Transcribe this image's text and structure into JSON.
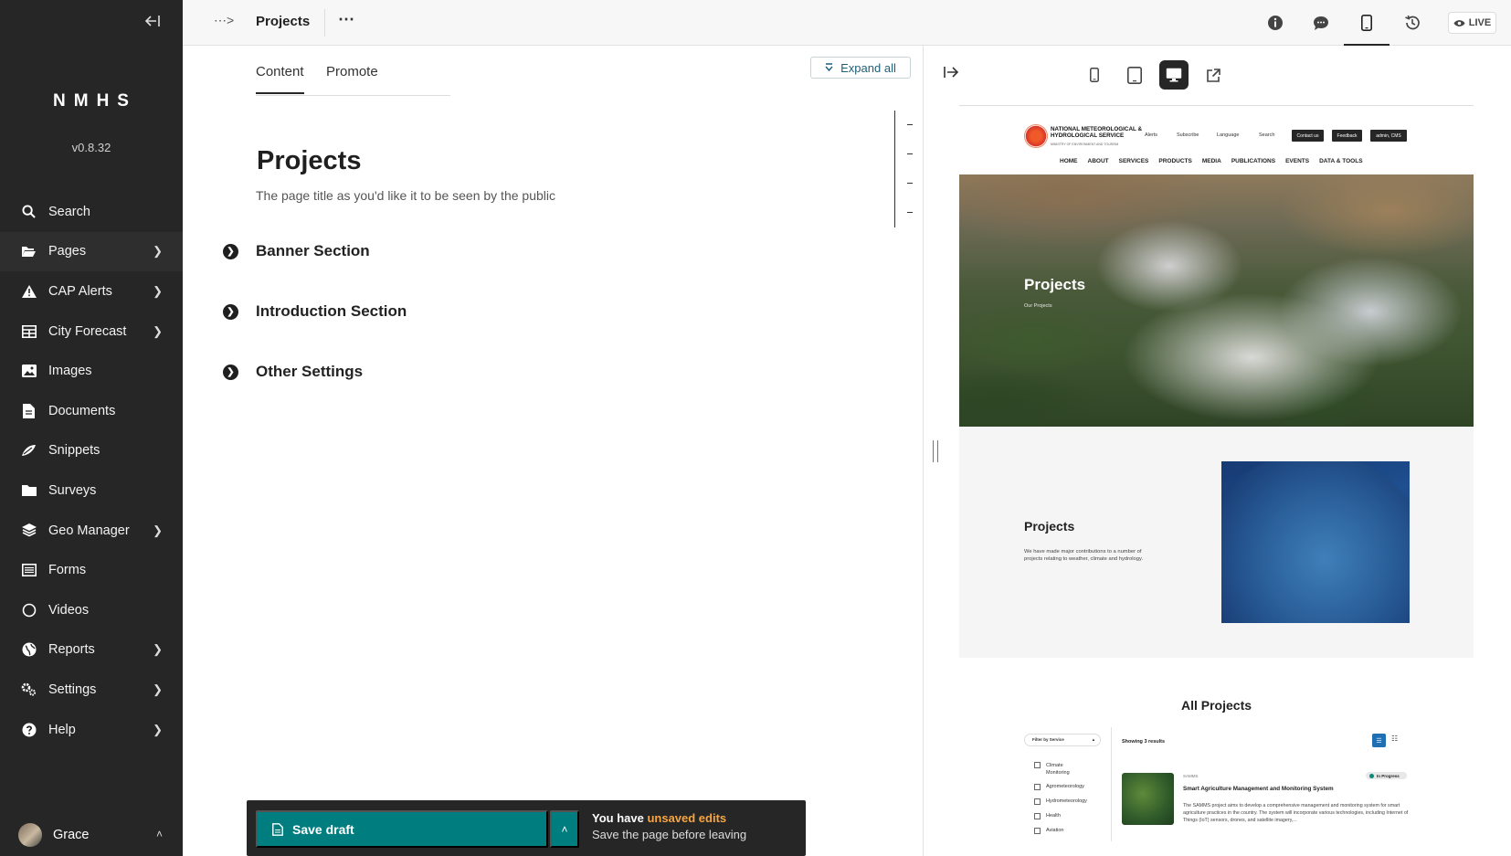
{
  "sidebar": {
    "logo": "NMHS",
    "version": "v0.8.32",
    "items": [
      {
        "label": "Search",
        "icon": "search-icon",
        "chevron": false
      },
      {
        "label": "Pages",
        "icon": "folder-open-icon",
        "chevron": true
      },
      {
        "label": "CAP Alerts",
        "icon": "warning-icon",
        "chevron": true
      },
      {
        "label": "City Forecast",
        "icon": "table-icon",
        "chevron": true
      },
      {
        "label": "Images",
        "icon": "image-icon",
        "chevron": false
      },
      {
        "label": "Documents",
        "icon": "document-icon",
        "chevron": false
      },
      {
        "label": "Snippets",
        "icon": "snippet-icon",
        "chevron": false
      },
      {
        "label": "Surveys",
        "icon": "folder-icon",
        "chevron": false
      },
      {
        "label": "Geo Manager",
        "icon": "layers-icon",
        "chevron": true
      },
      {
        "label": "Forms",
        "icon": "list-icon",
        "chevron": false
      },
      {
        "label": "Videos",
        "icon": "circle-icon",
        "chevron": false
      },
      {
        "label": "Reports",
        "icon": "globe-icon",
        "chevron": true
      },
      {
        "label": "Settings",
        "icon": "cogs-icon",
        "chevron": true
      },
      {
        "label": "Help",
        "icon": "help-icon",
        "chevron": true
      }
    ],
    "user": "Grace"
  },
  "header": {
    "title": "Projects",
    "live_label": "LIVE"
  },
  "editor": {
    "tabs": [
      {
        "label": "Content"
      },
      {
        "label": "Promote"
      }
    ],
    "expand_all": "Expand all",
    "title_value": "Projects",
    "title_help": "The page title as you'd like it to be seen by the public",
    "sections": [
      {
        "label": "Banner Section"
      },
      {
        "label": "Introduction Section"
      },
      {
        "label": "Other Settings"
      }
    ],
    "save_draft": "Save draft",
    "unsaved_prefix": "You have ",
    "unsaved_highlight": "unsaved edits",
    "unsaved_sub": "Save the page before leaving"
  },
  "preview": {
    "site_name": "NATIONAL METEOROLOGICAL & HYDROLOGICAL SERVICE",
    "site_sub": "MINISTRY OF ENVIRONMENT AND TOURISM",
    "util_links": [
      "Alerts",
      "Subscribe",
      "Language",
      "Search"
    ],
    "util_buttons": [
      "Contact us",
      "Feedback",
      "admin, CMS"
    ],
    "nav": [
      "HOME",
      "ABOUT",
      "SERVICES",
      "PRODUCTS",
      "MEDIA",
      "PUBLICATIONS",
      "EVENTS",
      "DATA & TOOLS"
    ],
    "hero_title": "Projects",
    "hero_crumb": "Our Projects",
    "intro_title": "Projects",
    "intro_text": "We have made major contributions to a number of projects relating to weather, climate and hydrology.",
    "all_projects": "All Projects",
    "filter_label": "Filter by Service",
    "filters": [
      "Climate Monitoring",
      "Agrometeorology",
      "Hydrometeorology",
      "Health",
      "Aviation"
    ],
    "showing": "Showing 3 results",
    "card": {
      "tag": "SAMMS",
      "status": "In Progress",
      "title": "Smart Agriculture Management and Monitoring System",
      "desc": "The SAMMS project aims to develop a comprehensive management and monitoring system for smart agriculture practices in the country. The system will incorporate various technologies, including Internet of Things (IoT) sensors, drones, and satellite imagery,..."
    }
  }
}
